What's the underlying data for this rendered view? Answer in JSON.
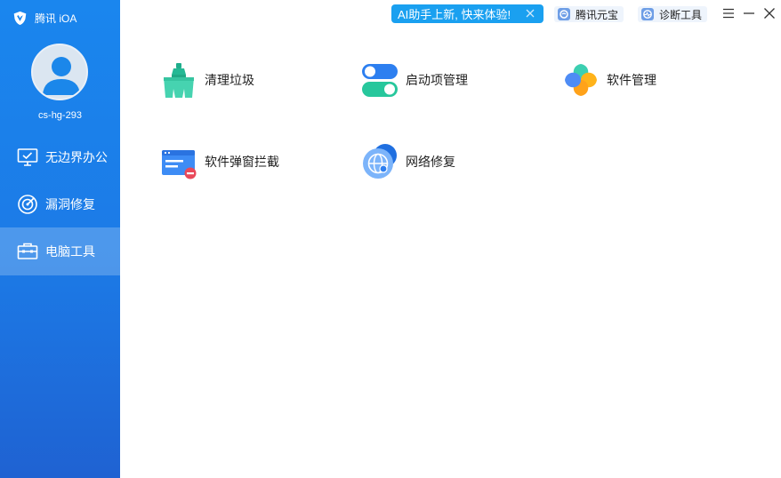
{
  "app": {
    "name": "腾讯 iOA"
  },
  "user": {
    "name": "cs-hg-293"
  },
  "sidebar": {
    "items": [
      {
        "label": "无边界办公",
        "icon": "monitor-check-icon",
        "active": false
      },
      {
        "label": "漏洞修复",
        "icon": "radar-icon",
        "active": false
      },
      {
        "label": "电脑工具",
        "icon": "toolbox-icon",
        "active": true
      }
    ]
  },
  "topbar": {
    "promo": {
      "text": "AI助手上新, 快来体验!",
      "icon": "close-icon"
    },
    "buttons": [
      {
        "label": "腾讯元宝",
        "icon": "yuanbao-icon"
      },
      {
        "label": "诊断工具",
        "icon": "diagnose-icon"
      }
    ],
    "window_controls": [
      "menu-icon",
      "minimize-icon",
      "close-icon"
    ]
  },
  "tools": [
    {
      "label": "清理垃圾",
      "icon": "broom-icon"
    },
    {
      "label": "启动项管理",
      "icon": "toggle-icon"
    },
    {
      "label": "软件管理",
      "icon": "clover-icon"
    },
    {
      "label": "软件弹窗拦截",
      "icon": "popup-block-icon"
    },
    {
      "label": "网络修复",
      "icon": "network-globe-icon"
    }
  ],
  "colors": {
    "sidebar_top": "#1a86ee",
    "sidebar_bottom": "#1f62d2",
    "promo_bg": "#1aa0f0",
    "accent": "#2d7ff0"
  }
}
